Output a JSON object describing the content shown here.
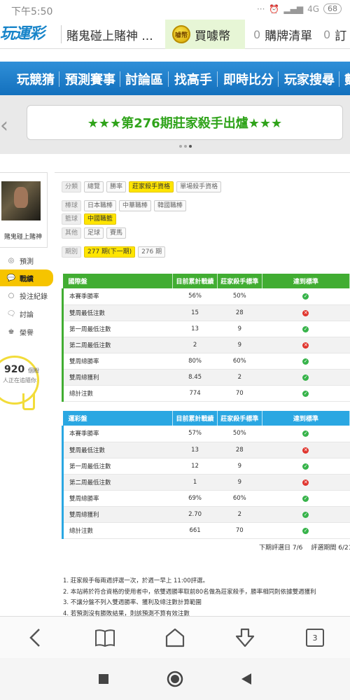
{
  "status_bar": {
    "time": "下午5:50",
    "network": "4G",
    "battery": "68"
  },
  "tabs": {
    "logo_text": "玩運彩",
    "current": "賭鬼碰上賭神 ...",
    "buy": "買噱幣",
    "coin_text": "噱幣",
    "betslip_count": "0",
    "betslip": "購牌清單",
    "other_count": "0",
    "other": "訂"
  },
  "nav": {
    "items": [
      "玩競猜",
      "預測賽事",
      "討論區",
      "找高手",
      "即時比分",
      "玩家搜尋",
      "數"
    ]
  },
  "banner": {
    "text": "★★★第276期莊家殺手出爐★★★"
  },
  "sidebar": {
    "username": "賭鬼碰上賭神",
    "items": [
      "預測",
      "戰績",
      "投注紀錄",
      "討論",
      "榮譽"
    ],
    "people_count": "920",
    "people_unit": "個粉",
    "people_sub": "人正在追隨你"
  },
  "filters": {
    "category_label": "分類",
    "category_options": [
      "總覽",
      "勝率",
      "莊家殺手資格",
      "單場殺手資格"
    ],
    "baseball_label": "棒球",
    "baseball_options": [
      "日本職棒",
      "中華職棒",
      "韓國職棒"
    ],
    "basketball_label": "籃球",
    "basketball_options": [
      "中國職籃"
    ],
    "other_label": "其他",
    "other_options": [
      "足球",
      "賽馬"
    ],
    "period_label": "期別",
    "period_options": [
      "277 期(下一期)",
      "276 期"
    ]
  },
  "table_headers": {
    "current": "目前累計戰績",
    "standard": "莊家殺手標準",
    "met": "達到標準"
  },
  "tables": [
    {
      "title": "國際盤",
      "rows": [
        {
          "label": "本賽季勝率",
          "current": "56%",
          "standard": "50%",
          "met": true
        },
        {
          "label": "雙周最低注數",
          "current": "15",
          "standard": "28",
          "met": false
        },
        {
          "label": "第一周最低注數",
          "current": "13",
          "standard": "9",
          "met": true
        },
        {
          "label": "第二周最低注數",
          "current": "2",
          "standard": "9",
          "met": false
        },
        {
          "label": "雙周總勝率",
          "current": "80%",
          "standard": "60%",
          "met": true
        },
        {
          "label": "雙周總獲利",
          "current": "8.45",
          "standard": "2",
          "met": true
        },
        {
          "label": "總計注數",
          "current": "774",
          "standard": "70",
          "met": true
        }
      ]
    },
    {
      "title": "運彩盤",
      "rows": [
        {
          "label": "本賽季勝率",
          "current": "57%",
          "standard": "50%",
          "met": true
        },
        {
          "label": "雙周最低注數",
          "current": "13",
          "standard": "28",
          "met": false
        },
        {
          "label": "第一周最低注數",
          "current": "12",
          "standard": "9",
          "met": true
        },
        {
          "label": "第二周最低注數",
          "current": "1",
          "standard": "9",
          "met": false
        },
        {
          "label": "雙周總勝率",
          "current": "69%",
          "standard": "60%",
          "met": true
        },
        {
          "label": "雙周總獲利",
          "current": "2.70",
          "standard": "2",
          "met": true
        },
        {
          "label": "總計注數",
          "current": "661",
          "standard": "70",
          "met": true
        }
      ]
    }
  ],
  "evaluation": {
    "next_day": "下期評選日 7/6",
    "period": "評選期間 6/21"
  },
  "notes": [
    "1. 莊家殺手每兩週評選一次，於週一早上 11:00評選。",
    "2. 本站將於符合資格的使用者中，依雙週勝率取前80名做為莊家殺手，勝率相同則依據雙週獲利",
    "3. 不讓分盤不列入雙週勝率、獲利及總注數計算範圍",
    "4. 若預測沒有勝敗結果，則該預測不算有效注數"
  ],
  "browser_toolbar": {
    "tab_count": "3"
  },
  "colors": {
    "nav_blue": "#1b7cc6",
    "green": "#41ad32",
    "blue": "#2aa7e2",
    "highlight": "#ffe500",
    "active_side": "#f6c400"
  }
}
